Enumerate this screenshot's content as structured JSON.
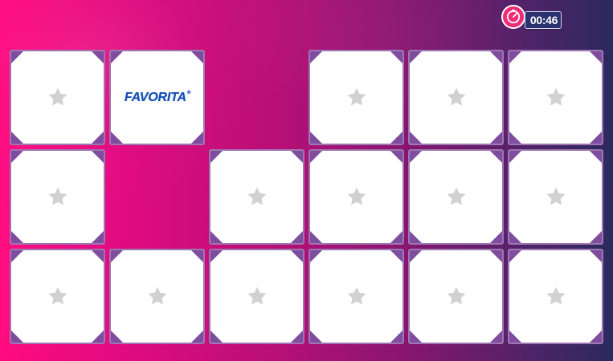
{
  "timer": {
    "time": "00:46",
    "icon": "stopwatch-icon",
    "pill_color": "#2a326f",
    "clock_color": "#ef2c75"
  },
  "board": {
    "cards": [
      {
        "row": 1,
        "col": 1,
        "state": "hidden",
        "icon": "star-icon"
      },
      {
        "row": 1,
        "col": 2,
        "state": "revealed",
        "logo_text": "FAVORITA",
        "logo_mark": "®"
      },
      {
        "row": 1,
        "col": 4,
        "state": "hidden",
        "icon": "star-icon"
      },
      {
        "row": 1,
        "col": 5,
        "state": "hidden",
        "icon": "star-icon"
      },
      {
        "row": 1,
        "col": 6,
        "state": "hidden",
        "icon": "star-icon"
      },
      {
        "row": 2,
        "col": 1,
        "state": "hidden",
        "icon": "star-icon"
      },
      {
        "row": 2,
        "col": 3,
        "state": "hidden",
        "icon": "star-icon"
      },
      {
        "row": 2,
        "col": 4,
        "state": "hidden",
        "icon": "star-icon"
      },
      {
        "row": 2,
        "col": 5,
        "state": "hidden",
        "icon": "star-icon"
      },
      {
        "row": 2,
        "col": 6,
        "state": "hidden",
        "icon": "star-icon"
      },
      {
        "row": 3,
        "col": 1,
        "state": "hidden",
        "icon": "star-icon"
      },
      {
        "row": 3,
        "col": 2,
        "state": "hidden",
        "icon": "star-icon"
      },
      {
        "row": 3,
        "col": 3,
        "state": "hidden",
        "icon": "star-icon"
      },
      {
        "row": 3,
        "col": 4,
        "state": "hidden",
        "icon": "star-icon"
      },
      {
        "row": 3,
        "col": 5,
        "state": "hidden",
        "icon": "star-icon"
      },
      {
        "row": 3,
        "col": 6,
        "state": "hidden",
        "icon": "star-icon"
      }
    ]
  },
  "colors": {
    "card_border": "#9e76b1",
    "card_corner": "#7e4d9f",
    "star": "#d1d1d1",
    "logo": "#1651b8",
    "background_left": "#ff0b7f",
    "background_right": "#2b2a5f"
  }
}
